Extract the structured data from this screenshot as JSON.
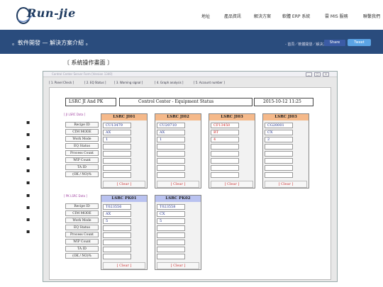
{
  "header": {
    "logo_text": "Run-jie",
    "nav": [
      "地址",
      "產品資訊",
      "解決方案",
      "軟體 ERP 系統",
      "雲 MIS 服務",
      "聯繫我們"
    ]
  },
  "banner": {
    "title": "。軟件開發 — 解決方案介紹 。",
    "breadcrumb": "- 首頁／軟體開發／解決方案 -",
    "share_label": "Share",
    "tweet_label": "Tweet"
  },
  "section_heading": "〔  系統操作畫面  〕",
  "side_glyphs": [
    "▪",
    "▪",
    "▪",
    "▪",
    "▪",
    "▪",
    "▪",
    "▪",
    "▪",
    "▪"
  ],
  "window": {
    "title": "Control Center Server Form   [Version 1340]",
    "controls": [
      "_",
      "□",
      "×"
    ],
    "tabs": [
      "[ 1. Panel Check ]",
      "[ 2. EQ Status ]",
      "[ 3. Warning signal ]",
      "[ 4. Graph analysis ]",
      "[ 5. Account number ]"
    ],
    "header_left": "LSRC  JI And PK",
    "header_center": "Control   Center  -  Equipment   Status",
    "header_date": "2015-10-12   11:25",
    "ji_group_label": "[ JI LSRC Data ]",
    "pk_group_label": "[ PK LSRC Data ]",
    "row_labels": [
      "Recipe ID",
      "CIM MODE",
      "Work Mode",
      "EQ Status",
      "Process Count",
      "WIP Count",
      "TA ID",
      "(OK / NO)%"
    ],
    "clear_label": "[  Clear  ]",
    "ji_equipment": [
      {
        "name": "LSRC JI01",
        "recipe": "CU13479",
        "cim": "AX",
        "work": "1",
        "head_color": "#f5b98a",
        "warn": false
      },
      {
        "name": "LSRC JI02",
        "recipe": "CU20710",
        "cim": "AX",
        "work": "1",
        "head_color": "#f5b98a",
        "warn": false
      },
      {
        "name": "LSRC JI03",
        "recipe": "CF13450",
        "cim": "BT",
        "work": "4",
        "head_color": "#f5b98a",
        "warn": true
      },
      {
        "name": "LSRC JI03",
        "recipe": "CG20001",
        "cim": "CX",
        "work": "2",
        "head_color": "#f5b98a",
        "warn": false
      }
    ],
    "pk_equipment": [
      {
        "name": "LSRC PK01",
        "recipe": "T023556",
        "cim": "AX",
        "work": "5",
        "head_color": "#b9c2f0",
        "warn": false
      },
      {
        "name": "LSRC PK02",
        "recipe": "T023558",
        "cim": "CX",
        "work": "5",
        "head_color": "#b9c2f0",
        "warn": false
      }
    ],
    "colors": {
      "normal_text": "#1c2d8c",
      "warn_text": "#cc2222",
      "clear_text": "#cc3333"
    }
  }
}
